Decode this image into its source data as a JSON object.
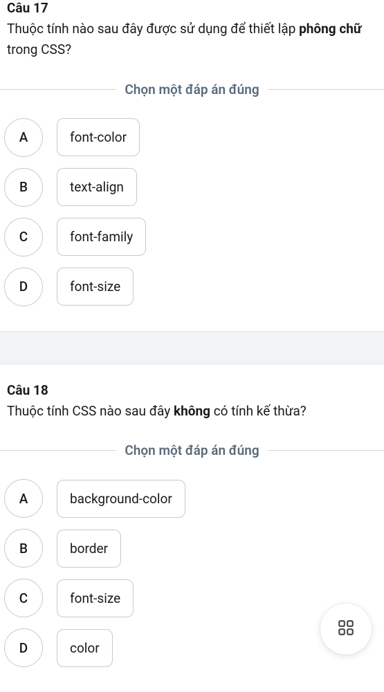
{
  "questions": [
    {
      "number": "Câu 17",
      "text_parts": [
        {
          "text": "Thuộc tính nào sau đây được sử dụng để thiết lập ",
          "bold": false
        },
        {
          "text": "phông chữ",
          "bold": true
        },
        {
          "text": " trong CSS?",
          "bold": false
        }
      ],
      "prompt": "Chọn một đáp án đúng",
      "options": [
        {
          "letter": "A",
          "text": "font-color"
        },
        {
          "letter": "B",
          "text": "text-align"
        },
        {
          "letter": "C",
          "text": "font-family"
        },
        {
          "letter": "D",
          "text": "font-size"
        }
      ]
    },
    {
      "number": "Câu 18",
      "text_parts": [
        {
          "text": "Thuộc tính CSS nào sau đây ",
          "bold": false
        },
        {
          "text": "không",
          "bold": true
        },
        {
          "text": " có tính kế thừa?",
          "bold": false
        }
      ],
      "prompt": "Chọn một đáp án đúng",
      "options": [
        {
          "letter": "A",
          "text": "background-color"
        },
        {
          "letter": "B",
          "text": "border"
        },
        {
          "letter": "C",
          "text": "font-size"
        },
        {
          "letter": "D",
          "text": "color"
        }
      ]
    }
  ],
  "fab": {
    "icon_name": "grid-icon"
  }
}
